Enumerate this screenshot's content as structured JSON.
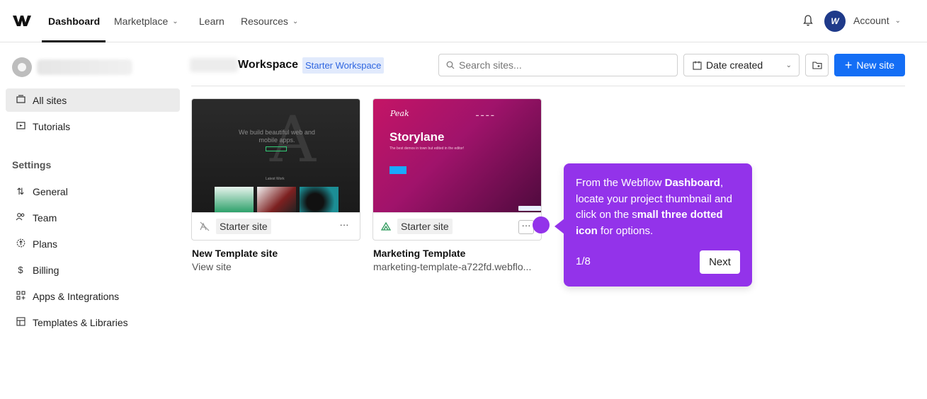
{
  "nav": {
    "items": [
      {
        "label": "Dashboard",
        "has_caret": false,
        "active": true
      },
      {
        "label": "Marketplace",
        "has_caret": true
      },
      {
        "label": "Learn",
        "has_caret": false
      },
      {
        "label": "Resources",
        "has_caret": true
      }
    ],
    "avatar_initial": "W",
    "account_label": "Account",
    "caret": "⌄"
  },
  "sidebar": {
    "items": [
      {
        "label": "All sites",
        "icon": "folder-icon",
        "active": true
      },
      {
        "label": "Tutorials",
        "icon": "tutorials-icon"
      }
    ],
    "settings_heading": "Settings",
    "settings_items": [
      {
        "label": "General",
        "icon": "general-icon"
      },
      {
        "label": "Team",
        "icon": "team-icon"
      },
      {
        "label": "Plans",
        "icon": "plans-icon"
      },
      {
        "label": "Billing",
        "icon": "billing-icon"
      },
      {
        "label": "Apps & Integrations",
        "icon": "apps-icon"
      },
      {
        "label": "Templates & Libraries",
        "icon": "templates-icon"
      }
    ]
  },
  "header": {
    "workspace_title": "Workspace",
    "workspace_badge": "Starter Workspace",
    "search_placeholder": "Search sites...",
    "sort_label": "Date created",
    "new_site_label": "New site"
  },
  "sites": [
    {
      "name": "New Template site",
      "subtitle": "View site",
      "plan": "Starter site",
      "thumb": {
        "tagline": "We build beautiful web and mobile apps.",
        "section": "Latest Work"
      }
    },
    {
      "name": "Marketing Template",
      "subtitle": "marketing-template-a722fd.webflo...",
      "plan": "Starter site",
      "thumb": {
        "brand": "Peak",
        "title": "Storylane",
        "sub": "The best demos in town but edited in the editor!"
      }
    }
  ],
  "tooltip": {
    "text_parts": [
      {
        "t": "From the Webflow ",
        "b": false
      },
      {
        "t": "Dashboard",
        "b": true
      },
      {
        "t": ", locate your project thumbnail and click on the s",
        "b": false
      },
      {
        "t": "mall three dotted icon",
        "b": true
      },
      {
        "t": " for options.",
        "b": false
      }
    ],
    "step": "1/8",
    "next_label": "Next"
  },
  "colors": {
    "accent": "#146ef5",
    "tooltip": "#9333ea",
    "badge_bg": "#e1eafc",
    "badge_text": "#2f66e0"
  }
}
